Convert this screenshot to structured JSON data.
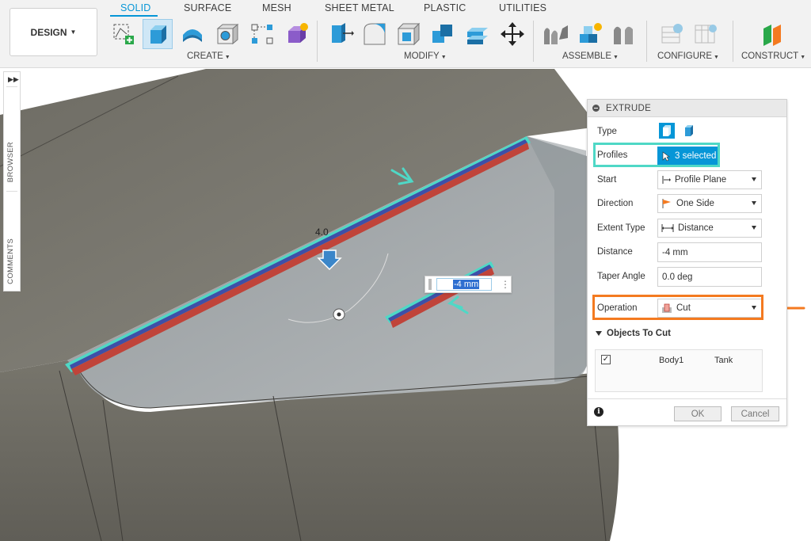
{
  "workspace": {
    "label": "DESIGN"
  },
  "tabs": [
    {
      "label": "SOLID",
      "active": true
    },
    {
      "label": "SURFACE",
      "active": false
    },
    {
      "label": "MESH",
      "active": false
    },
    {
      "label": "SHEET METAL",
      "active": false
    },
    {
      "label": "PLASTIC",
      "active": false
    },
    {
      "label": "UTILITIES",
      "active": false
    }
  ],
  "groups": {
    "create": "CREATE",
    "modify": "MODIFY",
    "assemble": "ASSEMBLE",
    "configure": "CONFIGURE",
    "construct": "CONSTRUCT"
  },
  "side_rail": {
    "browser": "BROWSER",
    "comments": "COMMENTS"
  },
  "canvas": {
    "dimension_value": "-4 mm",
    "dimension_label": "4.0"
  },
  "extrude": {
    "title": "EXTRUDE",
    "type_label": "Type",
    "profiles_label": "Profiles",
    "profiles_value": "3 selected",
    "start_label": "Start",
    "start_value": "Profile Plane",
    "direction_label": "Direction",
    "direction_value": "One Side",
    "extent_label": "Extent Type",
    "extent_value": "Distance",
    "distance_label": "Distance",
    "distance_value": "-4 mm",
    "taper_label": "Taper Angle",
    "taper_value": "0.0 deg",
    "operation_label": "Operation",
    "operation_value": "Cut",
    "objects_header": "Objects To Cut",
    "objects": [
      {
        "checked": true,
        "name": "Body1",
        "component": "Tank"
      }
    ],
    "ok_label": "OK",
    "cancel_label": "Cancel"
  },
  "colors": {
    "accent": "#0696d7",
    "highlight_teal": "#4fd8c6",
    "highlight_orange": "#f47a20",
    "body_gray": "#74726a",
    "cut_red": "#c0443a",
    "profile_blue": "#3e4fa8"
  },
  "icons": {
    "workspace_caret": "chevron-down-icon",
    "expand": "double-chevron-right-icon",
    "info": "info-icon"
  }
}
